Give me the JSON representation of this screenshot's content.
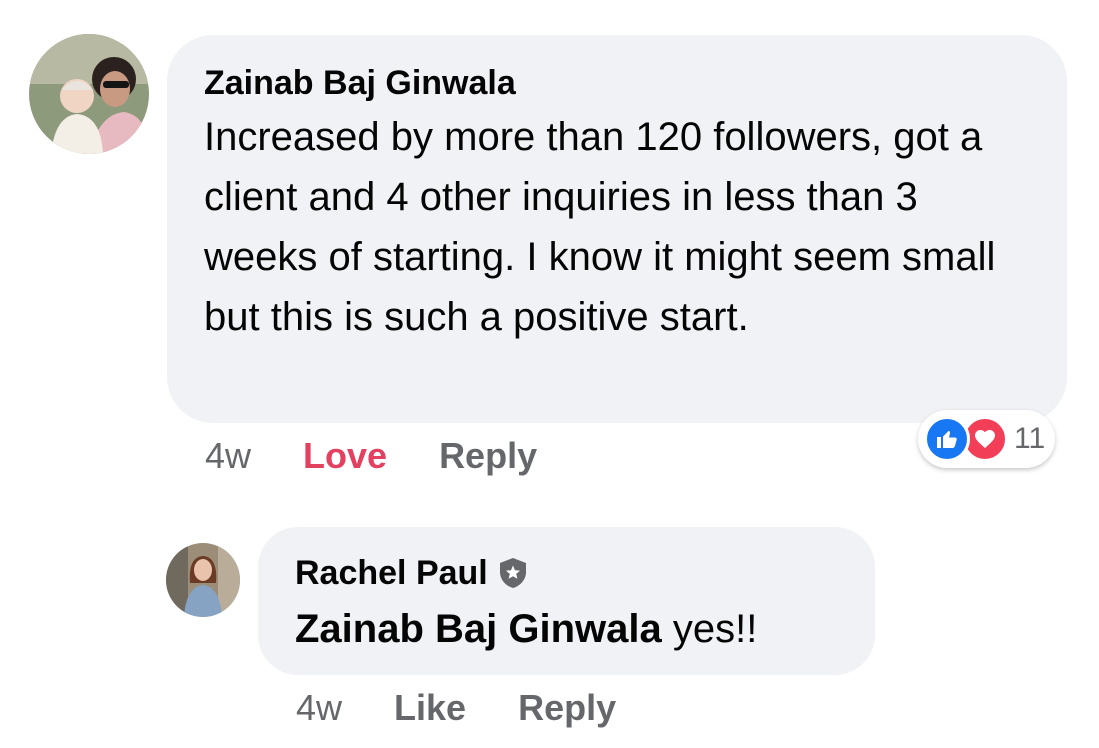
{
  "comments": [
    {
      "author": "Zainab Baj Ginwala",
      "text": "Increased by more than 120 followers, got a client and 4 other inquiries in less than 3 weeks of starting. I know it might seem small but this is such a positive start.",
      "time": "4w",
      "react_label": "Love",
      "reply_label": "Reply",
      "reactions": {
        "icons": [
          "thumbs-up-icon",
          "heart-icon"
        ],
        "count": "11",
        "like_color": "#1877f2",
        "love_color": "#f33e58"
      }
    },
    {
      "author": "Rachel Paul",
      "badge": "admin-shield-icon",
      "mention": "Zainab Baj Ginwala",
      "text": " yes!!",
      "time": "4w",
      "react_label": "Like",
      "reply_label": "Reply"
    }
  ],
  "colors": {
    "bubble": "#f0f2f5",
    "secondary_text": "#65676b",
    "love_active": "#e4405f"
  }
}
